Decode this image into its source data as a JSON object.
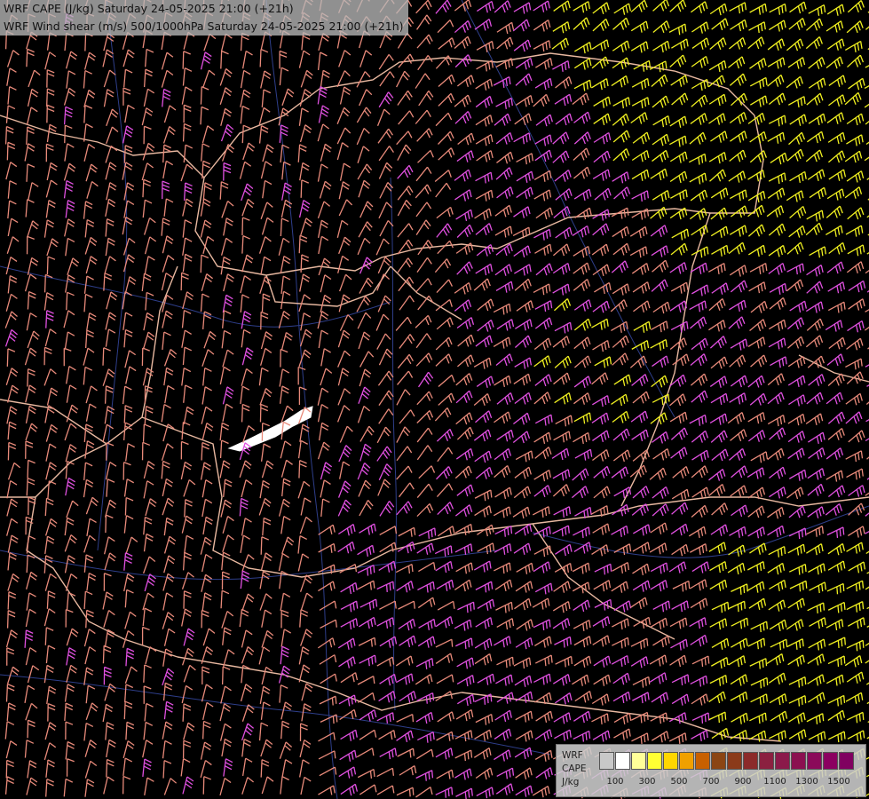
{
  "title": {
    "line1": "WRF CAPE (J/kg) Saturday 24-05-2025 21:00 (+21h)",
    "line2": "WRF Wind shear (m/s) 500/1000hPa Saturday 24-05-2025 21:00 (+21h)"
  },
  "legend": {
    "label1": "WRF",
    "label2": "CAPE",
    "label3": "J/kg",
    "ticks": [
      "100",
      "300",
      "500",
      "700",
      "900",
      "1100",
      "1300",
      "1500"
    ],
    "colors": [
      "#c8c8c8",
      "#ffffff",
      "#ffff99",
      "#ffff33",
      "#ffd700",
      "#f0a000",
      "#c86000",
      "#8b4513",
      "#8b3a1a",
      "#8b2a2a",
      "#8b2040",
      "#8b1a4a",
      "#8b1050",
      "#8b0a5a",
      "#8b0060",
      "#800060"
    ]
  },
  "barb_colors": {
    "low": "#e88a7a",
    "mid": "#e050e0",
    "high": "#f0f020"
  }
}
